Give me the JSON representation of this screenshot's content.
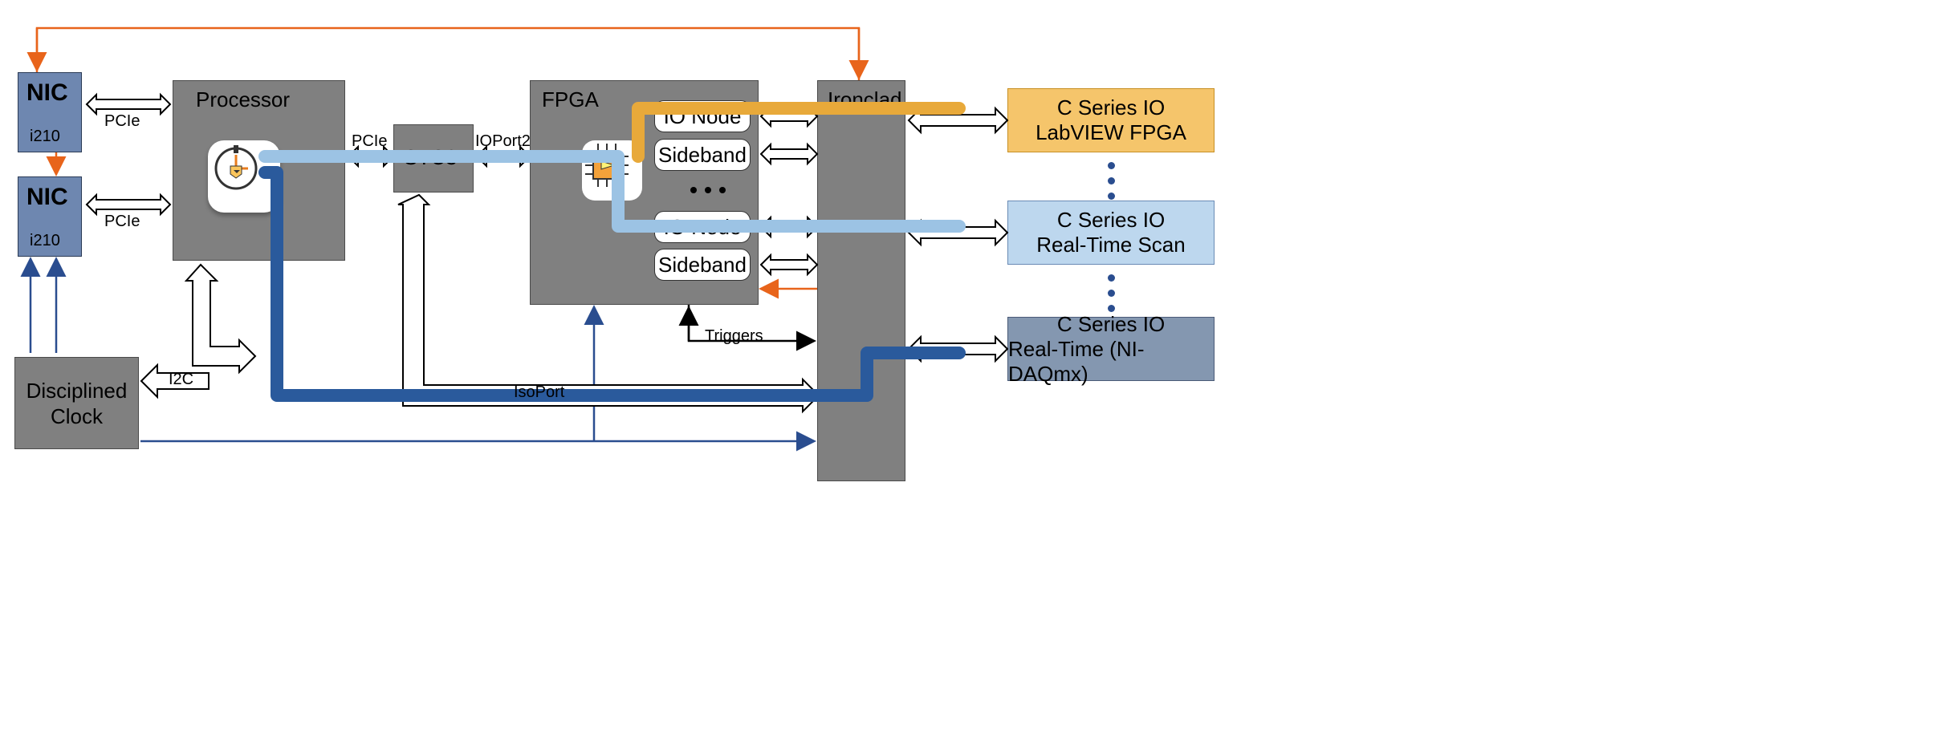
{
  "nodes": {
    "nic1": {
      "title": "NIC",
      "sub": "i210"
    },
    "nic2": {
      "title": "NIC",
      "sub": "i210"
    },
    "processor": "Processor",
    "stc3": "STC3",
    "fpga": "FPGA",
    "ionode1": "IO Node",
    "sideband1": "Sideband",
    "ionode2": "IO Node",
    "sideband2": "Sideband",
    "ironclad": "Ironclad",
    "disciplined": "Disciplined Clock",
    "cs_fpga_l1": "C Series IO",
    "cs_fpga_l2": "LabVIEW FPGA",
    "cs_scan_l1": "C Series IO",
    "cs_scan_l2": "Real-Time Scan",
    "cs_daq_l1": "C Series IO",
    "cs_daq_l2": "Real-Time (NI-DAQmx)"
  },
  "edges": {
    "pcie1": "PCIe",
    "pcie2": "PCIe",
    "pcie3": "PCIe",
    "i2c": "I2C",
    "ioport2": "IOPort2",
    "isoport": "IsoPort",
    "triggers": "Triggers"
  }
}
